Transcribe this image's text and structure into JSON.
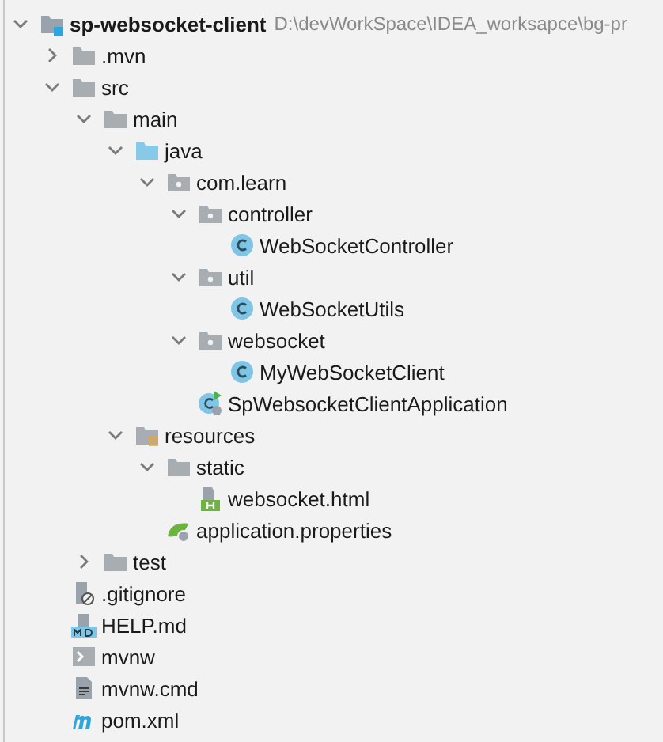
{
  "project_tree": [
    {
      "label": "sp-websocket-client",
      "path": "D:\\devWorkSpace\\IDEA_worksapce\\bg-pr",
      "kind": "module",
      "expanded": true,
      "children": [
        {
          "label": ".mvn",
          "kind": "folder",
          "expanded": false
        },
        {
          "label": "src",
          "kind": "folder",
          "expanded": true,
          "children": [
            {
              "label": "main",
              "kind": "folder",
              "expanded": true,
              "children": [
                {
                  "label": "java",
                  "kind": "source-folder",
                  "expanded": true,
                  "children": [
                    {
                      "label": "com.learn",
                      "kind": "package",
                      "expanded": true,
                      "children": [
                        {
                          "label": "controller",
                          "kind": "package",
                          "expanded": true,
                          "children": [
                            {
                              "label": "WebSocketController",
                              "kind": "class"
                            }
                          ]
                        },
                        {
                          "label": "util",
                          "kind": "package",
                          "expanded": true,
                          "children": [
                            {
                              "label": "WebSocketUtils",
                              "kind": "class"
                            }
                          ]
                        },
                        {
                          "label": "websocket",
                          "kind": "package",
                          "expanded": true,
                          "children": [
                            {
                              "label": "MyWebSocketClient",
                              "kind": "class"
                            }
                          ]
                        },
                        {
                          "label": "SpWebsocketClientApplication",
                          "kind": "boot-class"
                        }
                      ]
                    }
                  ]
                },
                {
                  "label": "resources",
                  "kind": "resources-folder",
                  "expanded": true,
                  "children": [
                    {
                      "label": "static",
                      "kind": "folder",
                      "expanded": true,
                      "children": [
                        {
                          "label": "websocket.html",
                          "kind": "html"
                        }
                      ]
                    },
                    {
                      "label": "application.properties",
                      "kind": "properties"
                    }
                  ]
                }
              ]
            },
            {
              "label": "test",
              "kind": "folder",
              "expanded": false
            }
          ]
        },
        {
          "label": ".gitignore",
          "kind": "ignore"
        },
        {
          "label": "HELP.md",
          "kind": "markdown"
        },
        {
          "label": "mvnw",
          "kind": "shell"
        },
        {
          "label": "mvnw.cmd",
          "kind": "text"
        },
        {
          "label": "pom.xml",
          "kind": "maven"
        }
      ]
    }
  ]
}
